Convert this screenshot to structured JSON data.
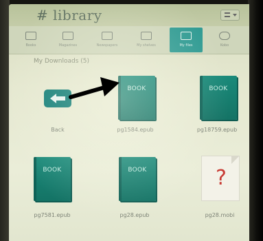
{
  "header": {
    "title": "library",
    "menu_icon": "menu-bars-icon"
  },
  "toolbar": {
    "items": [
      {
        "label": "Books",
        "icon": "books-icon"
      },
      {
        "label": "Magazines",
        "icon": "magazine-icon"
      },
      {
        "label": "Newspapers",
        "icon": "newspaper-icon"
      },
      {
        "label": "My shelves",
        "icon": "shelves-icon"
      },
      {
        "label": "My files",
        "icon": "files-icon",
        "active": true
      },
      {
        "label": "Kobo",
        "icon": "store-icon"
      }
    ],
    "active_color": "#2e9a92"
  },
  "section": {
    "label": "My Downloads (5)"
  },
  "tiles": [
    {
      "kind": "back",
      "label": "Back"
    },
    {
      "kind": "book",
      "cover_text": "BOOK",
      "label": "pg1584.epub"
    },
    {
      "kind": "book",
      "cover_text": "BOOK",
      "label": "pg18759.epub"
    },
    {
      "kind": "book",
      "cover_text": "BOOK",
      "label": "pg7581.epub"
    },
    {
      "kind": "book",
      "cover_text": "BOOK",
      "label": "pg28.epub"
    },
    {
      "kind": "unknown",
      "cover_text": "?",
      "label": "pg28.mobi"
    }
  ],
  "colors": {
    "book_cover": "#1a8a7a",
    "question_mark": "#c83c35",
    "screen_bg": "#e5e8d0"
  }
}
